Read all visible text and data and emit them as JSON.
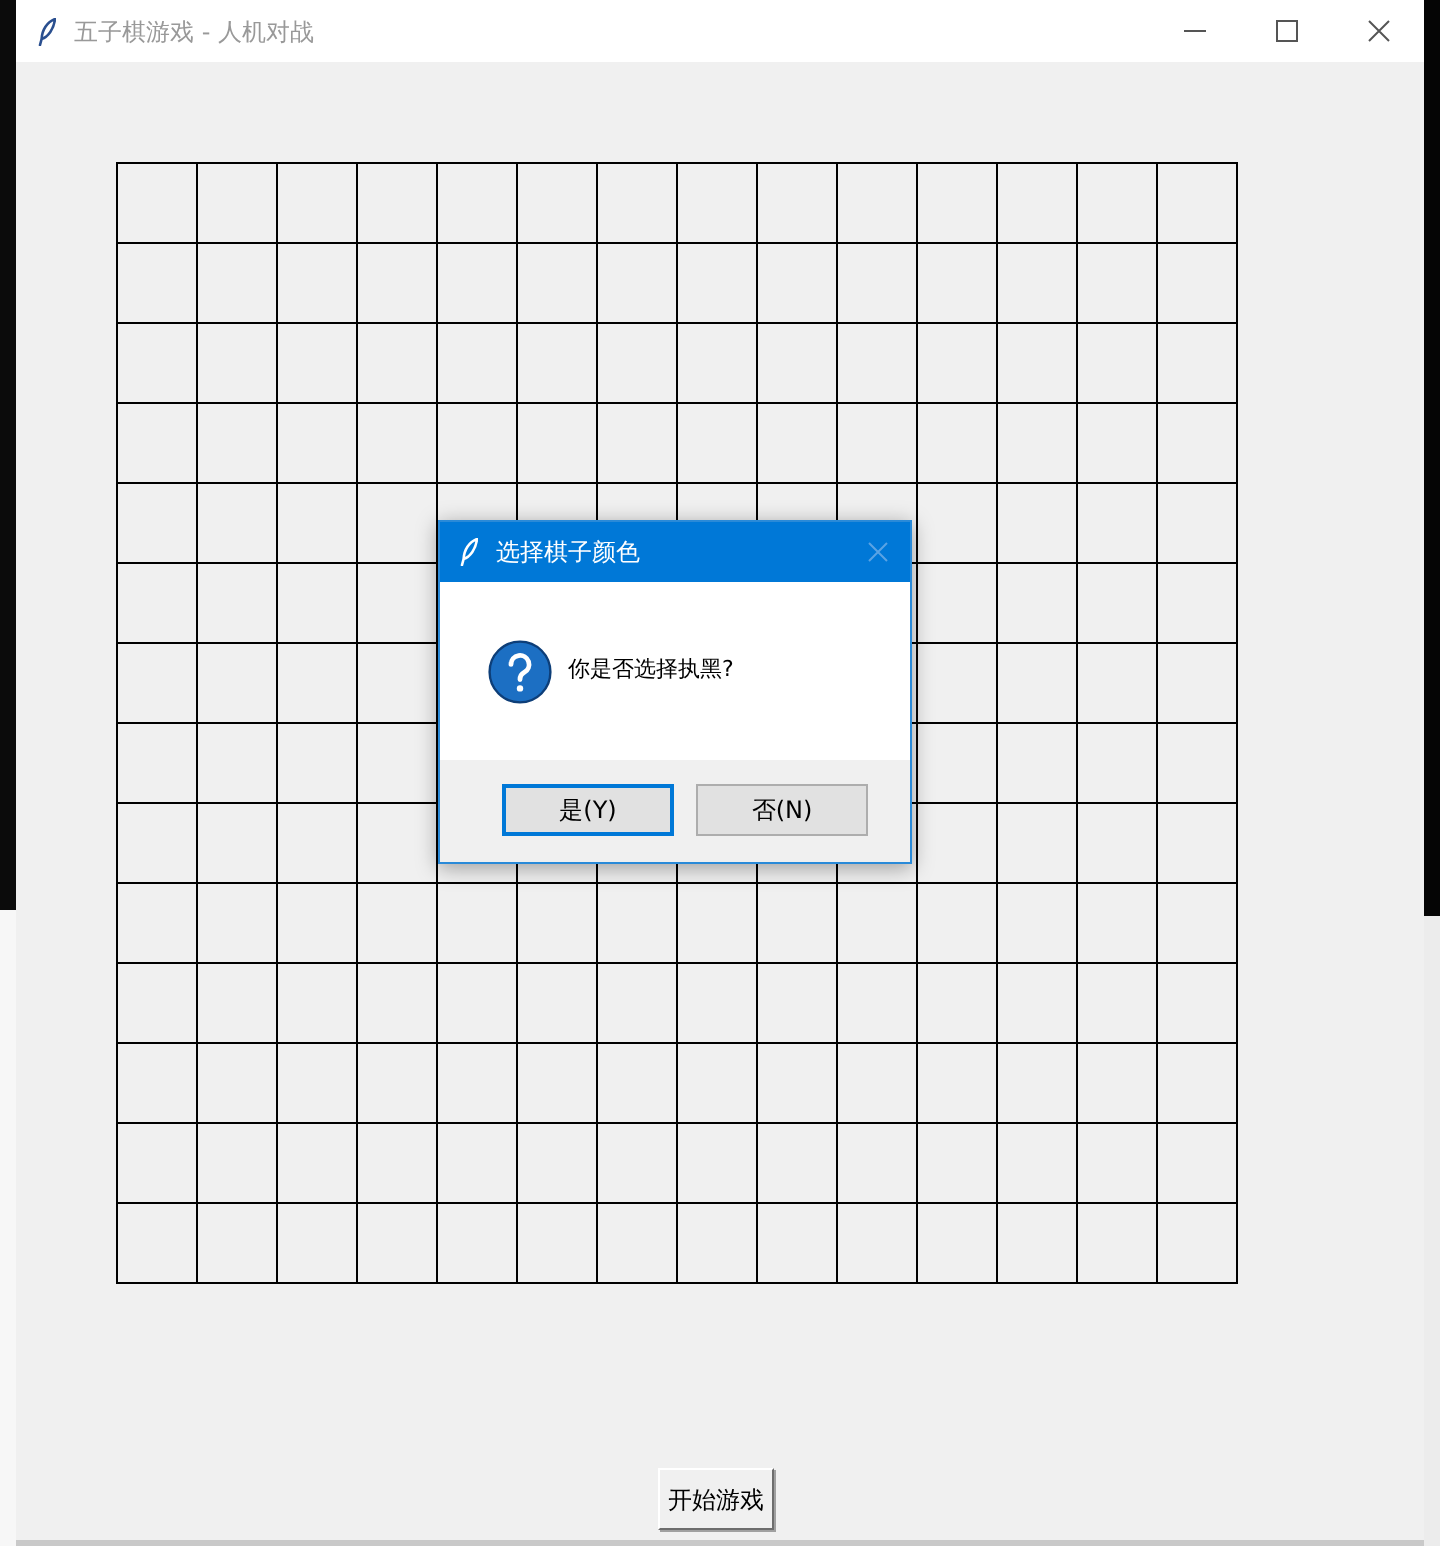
{
  "window": {
    "title": "五子棋游戏 - 人机对战"
  },
  "dialog": {
    "title": "选择棋子颜色",
    "message": "你是否选择执黑?",
    "buttons": [
      {
        "label": "是(Y)",
        "focused": true
      },
      {
        "label": "否(N)",
        "focused": false
      }
    ]
  },
  "start_button": {
    "label": "开始游戏"
  }
}
